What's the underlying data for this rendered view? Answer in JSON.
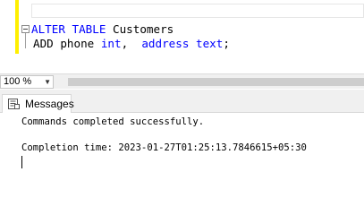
{
  "editor": {
    "lines": [
      {
        "keyword": "ALTER TABLE",
        "rest": " Customers"
      },
      {
        "keyword": "ADD",
        "parts": [
          " phone ",
          "int",
          ",  ",
          "address",
          " ",
          "text",
          ";"
        ]
      }
    ]
  },
  "zoom": {
    "value": "100 %"
  },
  "results": {
    "tab_label": "Messages",
    "messages": [
      "Commands completed successfully.",
      "Completion time: 2023-01-27T01:25:13.7846615+05:30"
    ]
  }
}
